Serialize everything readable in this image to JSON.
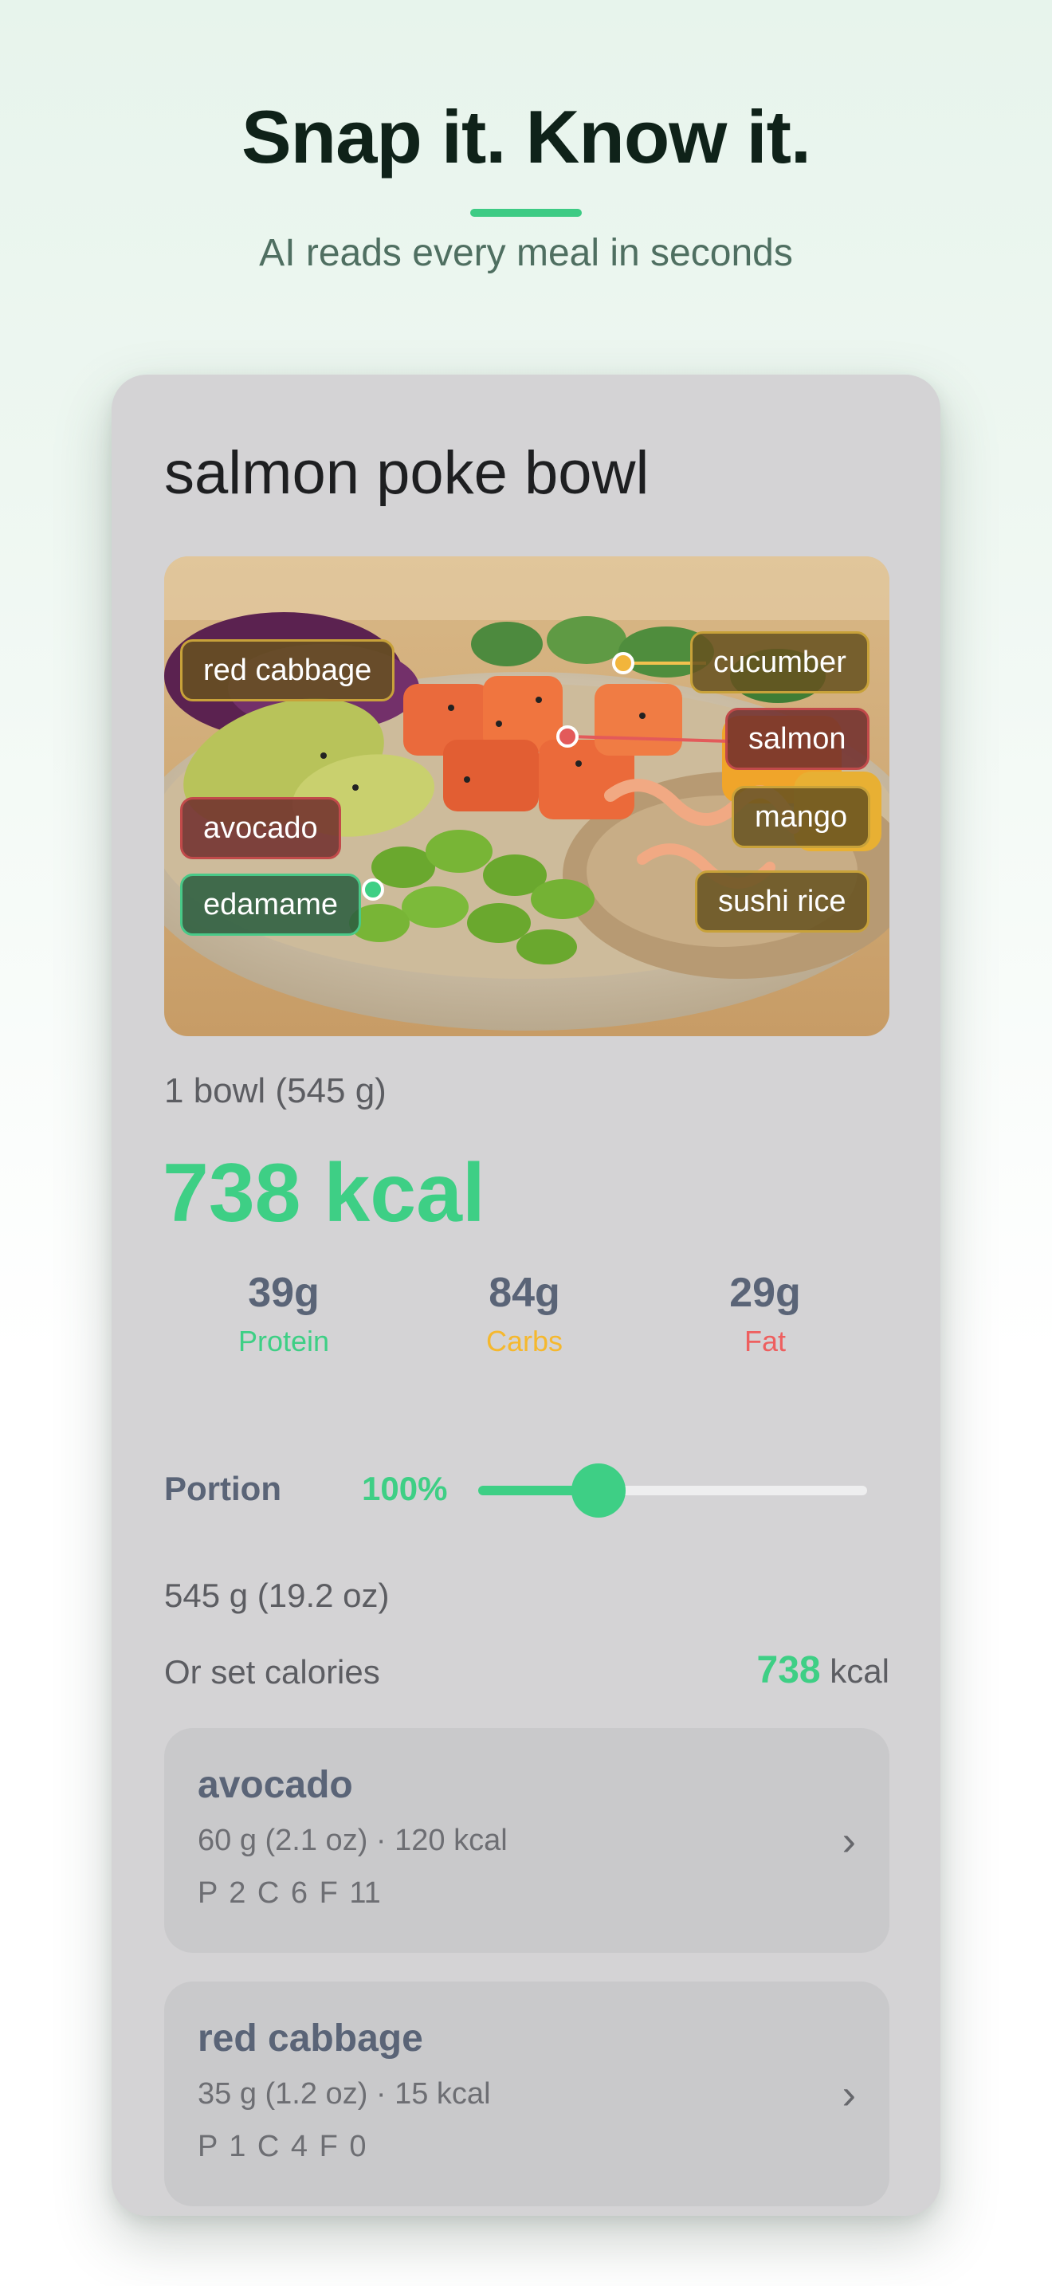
{
  "hero": {
    "title": "Snap it. Know it.",
    "subtitle": "AI reads every meal in seconds",
    "accent_color": "#3dcb84"
  },
  "meal": {
    "title": "salmon poke bowl",
    "photo_tags": [
      {
        "label": "red cabbage",
        "style": "olive"
      },
      {
        "label": "cucumber",
        "style": "olive"
      },
      {
        "label": "salmon",
        "style": "maroon"
      },
      {
        "label": "mango",
        "style": "olive"
      },
      {
        "label": "avocado",
        "style": "maroon"
      },
      {
        "label": "edamame",
        "style": "green"
      },
      {
        "label": "sushi rice",
        "style": "olive"
      }
    ],
    "serving": "1 bowl (545 g)",
    "calories": "738 kcal",
    "macros": [
      {
        "value": "39g",
        "label": "Protein",
        "color": "#3ecf85"
      },
      {
        "value": "84g",
        "label": "Carbs",
        "color": "#f5b82e"
      },
      {
        "value": "29g",
        "label": "Fat",
        "color": "#ee5f5f"
      }
    ]
  },
  "portion": {
    "label": "Portion",
    "percent_text": "100%",
    "slider_fraction": 0.31,
    "weight": "545 g (19.2 oz)",
    "set_calories_label": "Or set calories",
    "set_calories_value": "738",
    "set_calories_unit": "kcal"
  },
  "ingredients": [
    {
      "name": "avocado",
      "detail": "60 g (2.1 oz) · 120 kcal",
      "macros": "P 2  C 6  F 11",
      "chevron": "›"
    },
    {
      "name": "red cabbage",
      "detail": "35 g (1.2 oz) · 15 kcal",
      "macros": "P 1  C 4  F 0",
      "chevron": "›"
    }
  ]
}
